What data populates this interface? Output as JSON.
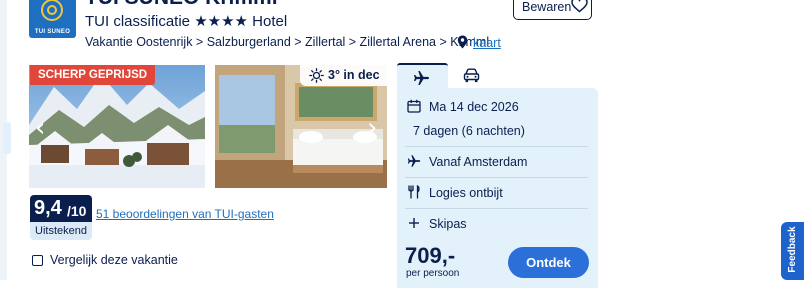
{
  "hotel": {
    "logo_text": "TUI SUNEO",
    "title": "TUI SUNEO Krimml",
    "classification": "TUI classificatie ★★★★ Hotel",
    "breadcrumb": "Vakantie Oostenrijk > Salzburgerland > Zillertal > Zillertal Arena > Krimml",
    "map_link": "kaart",
    "save_label": "Bewaren"
  },
  "gallery": {
    "badge": "SCHERP GEPRIJSD",
    "weather": "3° in dec",
    "icons": [
      "chevron-left-icon",
      "chevron-right-icon",
      "sun-icon"
    ]
  },
  "rating": {
    "score": "9,4",
    "max": "/10",
    "label": "Uitstekend",
    "reviews": "51 beoordelingen van TUI-gasten"
  },
  "compare": {
    "label": "Vergelijk deze vakantie",
    "checked": false
  },
  "booking": {
    "tabs": [
      {
        "name": "flight",
        "icon": "plane-icon",
        "active": true
      },
      {
        "name": "car",
        "icon": "car-icon",
        "active": false
      }
    ],
    "date": "Ma 14 dec 2026",
    "duration": "7 dagen (6 nachten)",
    "departure": "Vanaf Amsterdam",
    "board": "Logies ontbijt",
    "extra": "Skipas",
    "price": "709,-",
    "price_note": "per persoon",
    "cta": "Ontdek"
  },
  "feedback": {
    "label": "Feedback"
  },
  "colors": {
    "navy": "#0a1f4d",
    "link": "#1e6fbf",
    "cta": "#2b6fd8",
    "badge": "#e0463a",
    "panel": "#e3f1fb"
  }
}
